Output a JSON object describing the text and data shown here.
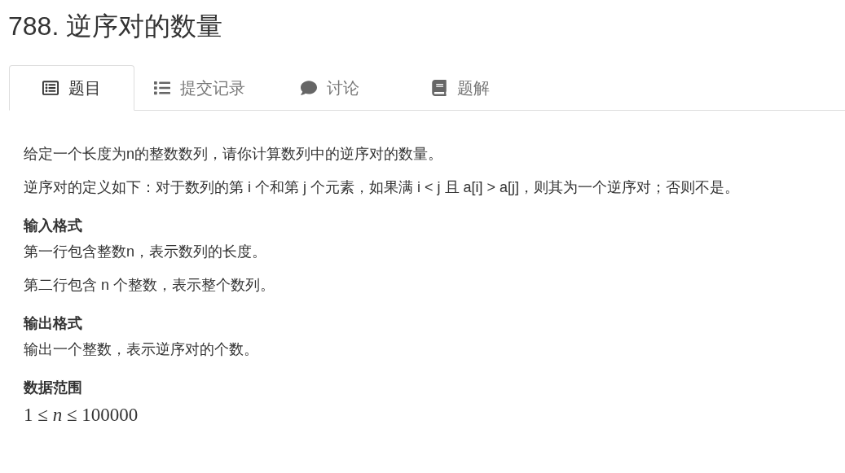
{
  "title": "788. 逆序对的数量",
  "tabs": [
    {
      "label": "题目",
      "selected": true
    },
    {
      "label": "提交记录",
      "selected": false
    },
    {
      "label": "讨论",
      "selected": false
    },
    {
      "label": "题解",
      "selected": false
    }
  ],
  "content": [
    {
      "kind": "paragraph",
      "text": "给定一个长度为n的整数数列，请你计算数列中的逆序对的数量。"
    },
    {
      "kind": "paragraph",
      "text": "逆序对的定义如下：对于数列的第 i 个和第 j 个元素，如果满 i < j 且 a[i] > a[j]，则其为一个逆序对；否则不是。"
    },
    {
      "kind": "heading",
      "text": "输入格式"
    },
    {
      "kind": "paragraph",
      "text": "第一行包含整数n，表示数列的长度。"
    },
    {
      "kind": "paragraph",
      "text": "第二行包含 n 个整数，表示整个数列。"
    },
    {
      "kind": "heading",
      "text": "输出格式"
    },
    {
      "kind": "paragraph",
      "text": "输出一个整数，表示逆序对的个数。"
    },
    {
      "kind": "heading",
      "text": "数据范围"
    },
    {
      "kind": "math",
      "text": "1 ≤ *n* ≤ 100000"
    }
  ]
}
